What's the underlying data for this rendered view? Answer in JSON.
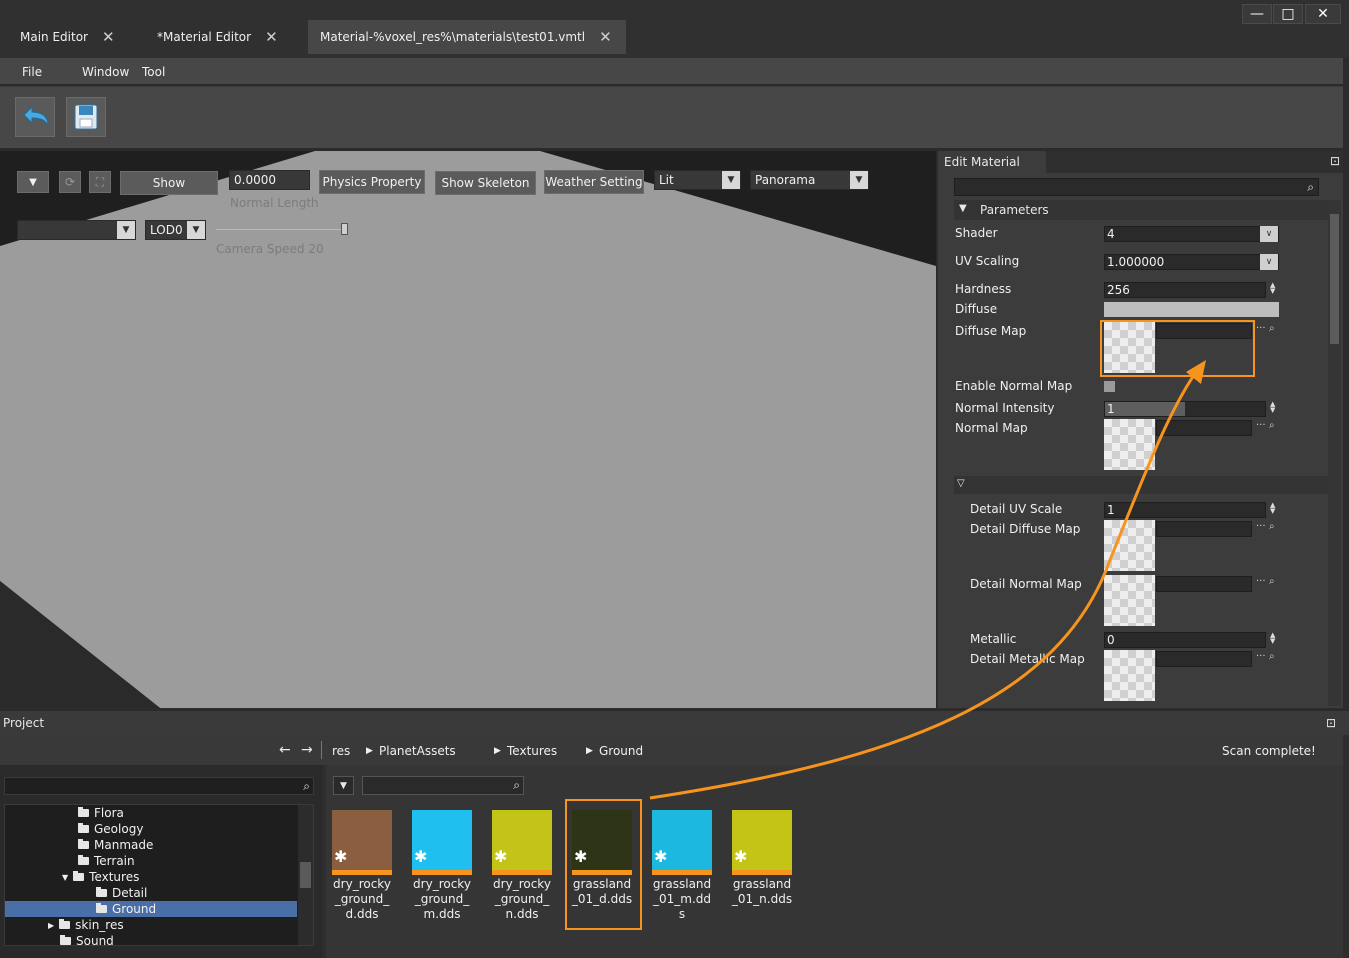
{
  "tabs": [
    {
      "label": "Main Editor",
      "active": false
    },
    {
      "label": "*Material Editor",
      "active": false
    },
    {
      "label": "Material-%voxel_res%\\materials\\test01.vmtl",
      "active": true
    }
  ],
  "window_controls": {
    "minimize": "—",
    "maximize": "□",
    "close": "✕"
  },
  "menu": {
    "file": "File",
    "window": "Window",
    "tool": "Tool"
  },
  "viewport": {
    "show_button": "Show",
    "normal_length_value": "0.0000",
    "normal_length_label": "Normal Length",
    "physics_property": "Physics Property",
    "show_skeleton": "Show Skeleton",
    "weather_setting": "Weather Setting",
    "lighting_mode": "Lit",
    "background_mode": "Panorama",
    "lod": "LOD0",
    "camera_speed_label": "Camera Speed 20",
    "camera_speed": 20
  },
  "edit_material": {
    "title": "Edit Material",
    "parameters_header": "Parameters",
    "shader_label": "Shader",
    "shader_value": "4",
    "uv_scaling_label": "UV Scaling",
    "uv_scaling_value": "1.000000",
    "hardness_label": "Hardness",
    "hardness_value": "256",
    "diffuse_label": "Diffuse",
    "diffuse_map_label": "Diffuse Map",
    "enable_normal_map_label": "Enable Normal Map",
    "normal_intensity_label": "Normal Intensity",
    "normal_intensity_value": "1",
    "normal_map_label": "Normal Map",
    "detail_uv_scale_label": "Detail UV Scale",
    "detail_uv_scale_value": "1",
    "detail_diffuse_map_label": "Detail Diffuse Map",
    "detail_normal_map_label": "Detail Normal Map",
    "metallic_label": "Metallic",
    "metallic_value": "0",
    "detail_metallic_map_label": "Detail Metallic Map",
    "browse_label": "···"
  },
  "project": {
    "title": "Project",
    "breadcrumb": [
      "res",
      "PlanetAssets",
      "Textures",
      "Ground"
    ],
    "status": "Scan complete!",
    "tree": [
      {
        "label": "Flora",
        "selected": false
      },
      {
        "label": "Geology",
        "selected": false
      },
      {
        "label": "Manmade",
        "selected": false
      },
      {
        "label": "Terrain",
        "selected": false
      },
      {
        "label": "Textures",
        "selected": false
      },
      {
        "label": "Detail",
        "selected": false
      },
      {
        "label": "Ground",
        "selected": true
      },
      {
        "label": "skin_res",
        "selected": false
      },
      {
        "label": "Sound",
        "selected": false
      }
    ],
    "assets": [
      {
        "name": "dry_rocky_ground_d.dds",
        "color": "#8a5e3f"
      },
      {
        "name": "dry_rocky_ground_m.dds",
        "color": "#1fbff0"
      },
      {
        "name": "dry_rocky_ground_n.dds",
        "color": "#c2c417"
      },
      {
        "name": "grassland_01_d.dds",
        "color": "#2e3516"
      },
      {
        "name": "grassland_01_m.dds",
        "color": "#1cb8e0"
      },
      {
        "name": "grassland_01_n.dds",
        "color": "#c4c416"
      }
    ]
  },
  "colors": {
    "highlight": "#f7941d",
    "selection": "#4a6ea8"
  }
}
